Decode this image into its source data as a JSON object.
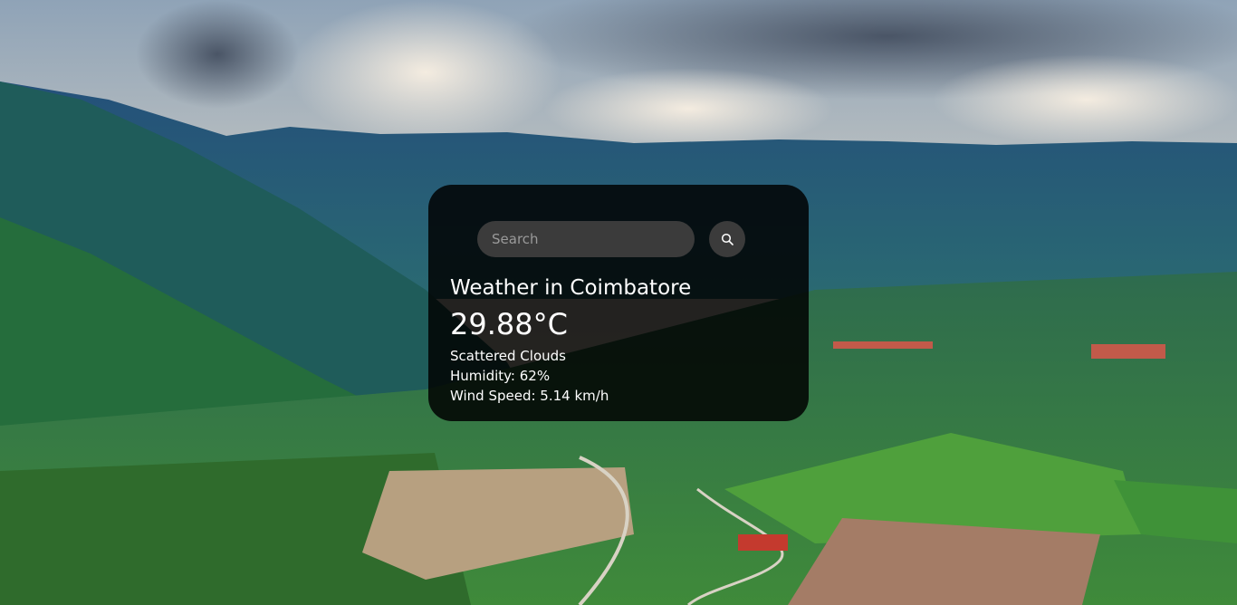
{
  "search": {
    "placeholder": "Search",
    "button_icon": "search-icon"
  },
  "weather": {
    "title": "Weather in Coimbatore",
    "temperature": "29.88°C",
    "description": "Scattered Clouds",
    "humidity": "Humidity: 62%",
    "wind": "Wind Speed: 5.14 km/h"
  },
  "colors": {
    "card_background": "#000000",
    "input_background": "#3b3b3b",
    "text": "#ffffff"
  }
}
